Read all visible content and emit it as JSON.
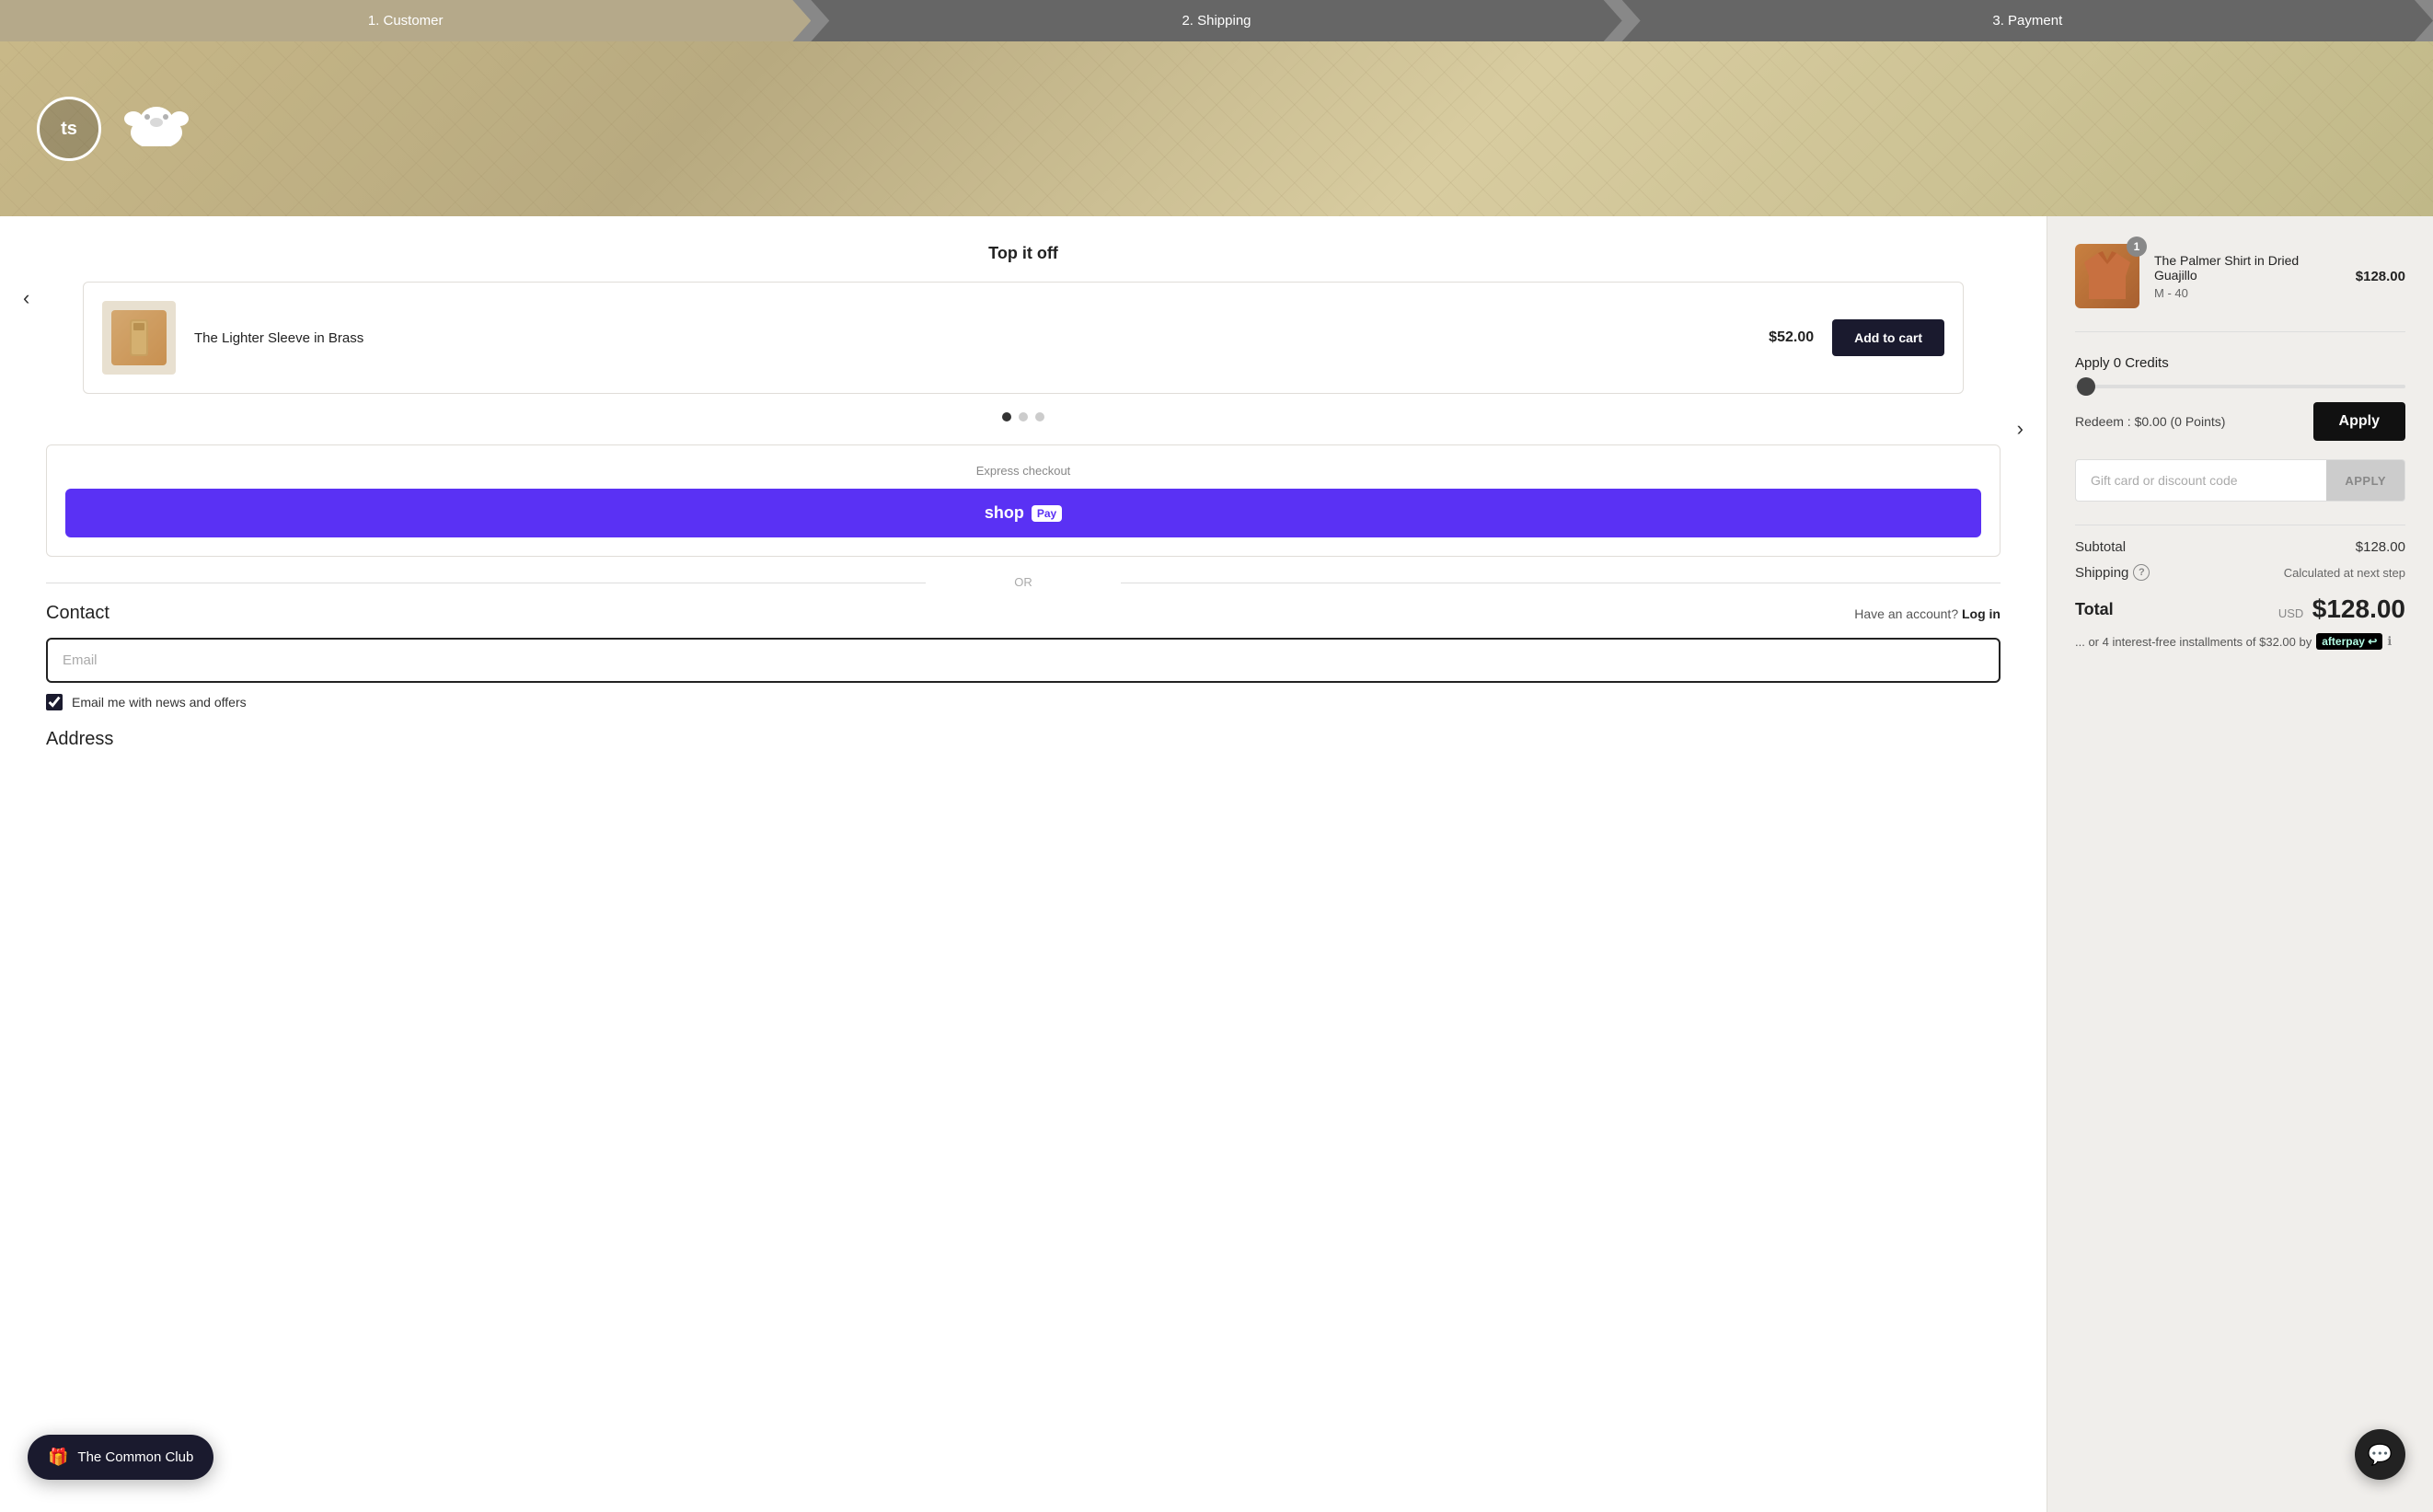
{
  "progress": {
    "steps": [
      {
        "label": "1. Customer",
        "state": "active"
      },
      {
        "label": "2. Shipping",
        "state": "inactive"
      },
      {
        "label": "3. Payment",
        "state": "inactive"
      }
    ]
  },
  "hero": {
    "logo_text": "ts",
    "bear_symbol": "🐻"
  },
  "top_it_off": {
    "title": "Top it off",
    "product": {
      "name": "The Lighter Sleeve in Brass",
      "price": "$52.00"
    },
    "add_to_cart_label": "Add to cart",
    "dots": [
      {
        "active": true
      },
      {
        "active": false
      },
      {
        "active": false
      }
    ]
  },
  "express_checkout": {
    "label": "Express checkout",
    "shop_pay_text": "shop",
    "shop_pay_badge": "Pay"
  },
  "or_label": "OR",
  "contact": {
    "title": "Contact",
    "have_account": "Have an account?",
    "login_label": "Log in",
    "email_placeholder": "Email",
    "checkbox_label": "Email me with news and offers"
  },
  "address": {
    "title": "Address"
  },
  "cart": {
    "item": {
      "name": "The Palmer Shirt in Dried Guajillo",
      "variant": "M - 40",
      "price": "$128.00",
      "quantity": "1"
    }
  },
  "credits": {
    "label": "Apply 0 Credits",
    "redeem_text": "Redeem : $0.00 (0 Points)",
    "apply_label": "Apply"
  },
  "discount": {
    "placeholder": "Gift card or discount code",
    "apply_label": "APPLY"
  },
  "totals": {
    "subtotal_label": "Subtotal",
    "subtotal_value": "$128.00",
    "shipping_label": "Shipping",
    "shipping_info_icon": "?",
    "shipping_value": "Calculated at next step",
    "total_label": "Total",
    "total_currency": "USD",
    "total_value": "$128.00",
    "afterpay_text": "... or 4 interest-free installments of $32.00 by",
    "afterpay_logo": "afterpay",
    "afterpay_arrow": "⮐",
    "afterpay_info": "ℹ"
  },
  "common_club": {
    "label": "The Common Club",
    "icon": "🎁"
  },
  "chat": {
    "icon": "💬"
  }
}
